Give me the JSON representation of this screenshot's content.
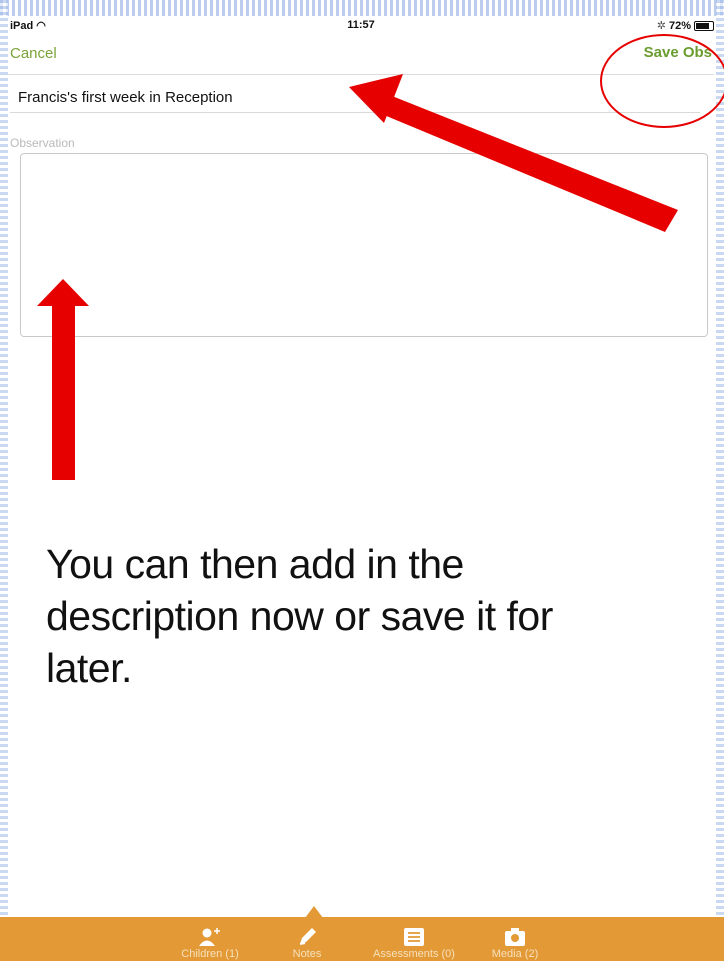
{
  "status_bar": {
    "device": "iPad",
    "time": "11:57",
    "battery": "72%",
    "battery_level": 0.72
  },
  "nav": {
    "cancel_label": "Cancel",
    "save_label": "Save Obs"
  },
  "form": {
    "title_value": "Francis's first week in Reception",
    "observation_label": "Observation",
    "observation_value": ""
  },
  "annotation": {
    "text": "You can then add in the description now or save it for later."
  },
  "colors": {
    "accent_green": "#6b9c2f",
    "tab_orange": "#e39a36",
    "arrow_red": "#e60000"
  },
  "tabs": [
    {
      "label": "Children (1)",
      "icon": "add-child-icon"
    },
    {
      "label": "Notes",
      "icon": "pencil-icon"
    },
    {
      "label": "Assessments (0)",
      "icon": "list-icon"
    },
    {
      "label": "Media (2)",
      "icon": "camera-icon"
    }
  ]
}
